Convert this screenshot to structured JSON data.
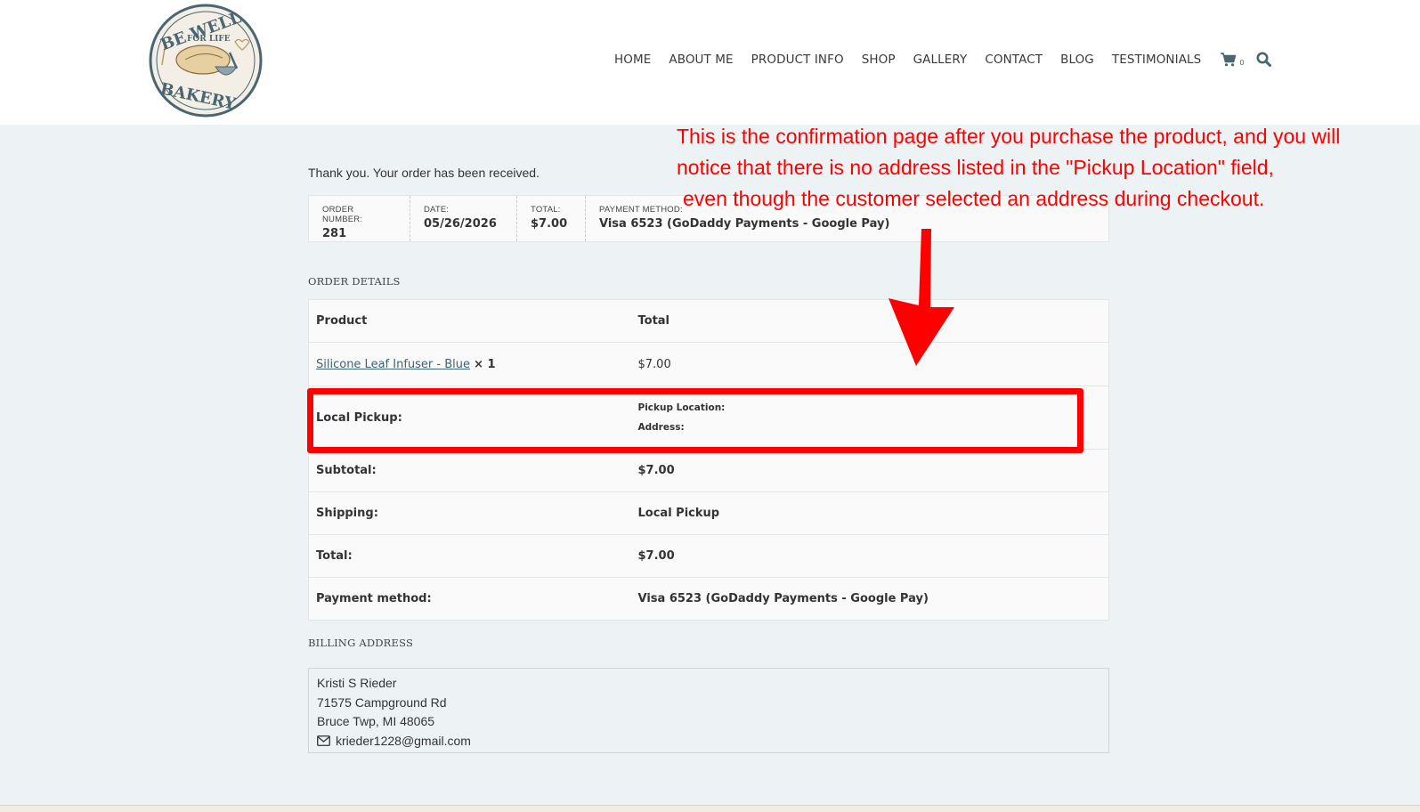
{
  "header": {
    "logo": {
      "line1": "BE WELL",
      "line2": "FOR LIFE",
      "line3": "BAKERY"
    },
    "nav": [
      "HOME",
      "ABOUT ME",
      "PRODUCT INFO",
      "SHOP",
      "GALLERY",
      "CONTACT",
      "BLOG",
      "TESTIMONIALS"
    ],
    "cart_count": "0",
    "icons": [
      "cart-icon",
      "search-icon"
    ]
  },
  "order": {
    "thank_you": "Thank you. Your order has been received.",
    "overview": {
      "order_number_label": "ORDER NUMBER:",
      "order_number": "281",
      "date_label": "DATE:",
      "date": "05/26/2026",
      "total_label": "TOTAL:",
      "total": "$7.00",
      "payment_label": "PAYMENT METHOD:",
      "payment": "Visa 6523 (GoDaddy Payments - Google Pay)"
    },
    "details_title": "ORDER DETAILS",
    "table": {
      "col_product": "Product",
      "col_total": "Total",
      "item_name": "Silicone Leaf Infuser - Blue",
      "item_qty": "× 1",
      "item_total": "$7.00",
      "pickup_label": "Local Pickup:",
      "pickup_location_label": "Pickup Location:",
      "pickup_address_label": "Address:",
      "subtotal_label": "Subtotal:",
      "subtotal": "$7.00",
      "shipping_label": "Shipping:",
      "shipping": "Local Pickup",
      "total_label": "Total:",
      "total": "$7.00",
      "payment_label": "Payment method:",
      "payment": "Visa 6523 (GoDaddy Payments - Google Pay)"
    },
    "billing_title": "BILLING ADDRESS",
    "billing": {
      "name": "Kristi S Rieder",
      "street": "71575 Campground Rd",
      "city": "Bruce Twp, MI 48065",
      "email": "krieder1228@gmail.com"
    }
  },
  "annotation": {
    "line1": "This is the confirmation page after you purchase the product, and you will",
    "line2": "notice that there is no address listed in the \"Pickup Location\" field,",
    "line3": "even though the customer selected an address during checkout.",
    "color": "#ff0000"
  },
  "colors": {
    "accent": "#3d6470",
    "background": "#edf3f5",
    "highlight": "#ff0000"
  }
}
